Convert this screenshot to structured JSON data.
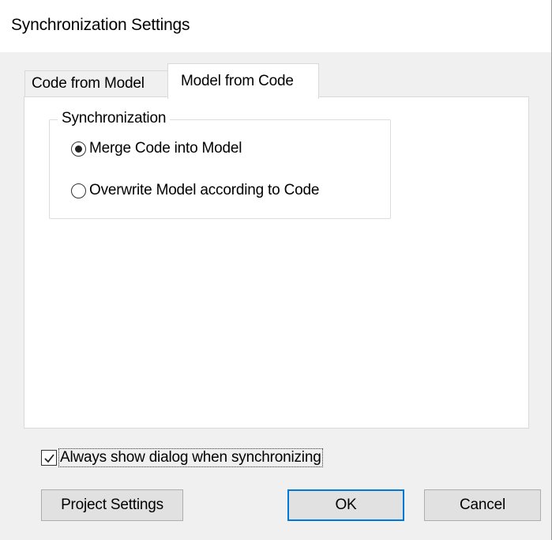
{
  "window": {
    "title": "Synchronization Settings"
  },
  "tabs": [
    {
      "label": "Code from Model",
      "active": false
    },
    {
      "label": "Model from Code",
      "active": true
    }
  ],
  "group": {
    "legend": "Synchronization",
    "options": [
      {
        "label": "Merge Code into Model",
        "selected": true
      },
      {
        "label": "Overwrite Model according to Code",
        "selected": false
      }
    ]
  },
  "checkbox": {
    "label": "Always show dialog when synchronizing",
    "checked": true
  },
  "buttons": {
    "project_settings": "Project Settings",
    "ok": "OK",
    "cancel": "Cancel"
  },
  "colors": {
    "accent": "#0078d7",
    "panel": "#ffffff",
    "dialog_bg": "#f0f0f0"
  }
}
